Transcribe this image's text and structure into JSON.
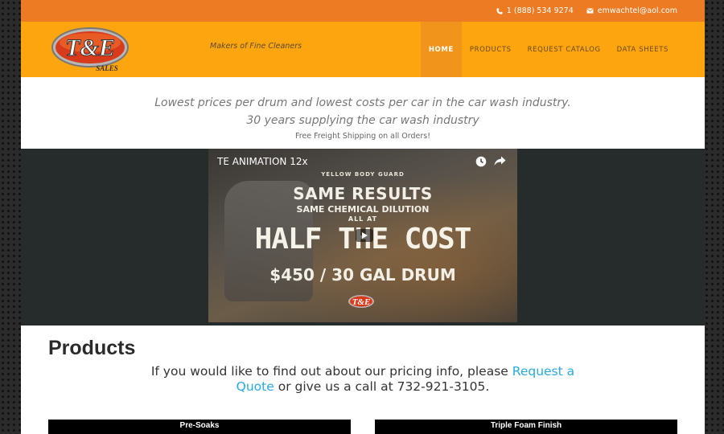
{
  "topbar": {
    "phone": "1 (888) 534 9274",
    "email": "emwachtel@aol.com"
  },
  "header": {
    "logo_text": "T&E",
    "logo_sub": "SALES",
    "tagline": "Makers of Fine Cleaners",
    "nav": [
      {
        "label": "HOME",
        "active": true
      },
      {
        "label": "PRODUCTS",
        "active": false
      },
      {
        "label": "REQUEST CATALOG",
        "active": false
      },
      {
        "label": "DATA SHEETS",
        "active": false
      }
    ]
  },
  "intro": {
    "line1": "Lowest prices per drum and lowest costs per car in the car wash industry.",
    "line2": "30 years supplying the car wash industry",
    "line3": "Free Freight Shipping on all Orders!"
  },
  "video": {
    "title": "TE ANIMATION 12x",
    "overlay_small": "YELLOW BODY GUARD",
    "overlay_big": "SAME RESULTS",
    "overlay_sub": "SAME CHEMICAL DILUTION",
    "overlay_allat": "ALL AT",
    "overlay_huge": "HALF THE COST",
    "overlay_price": "$450 / 30 GAL DRUM",
    "icons": [
      "clock-icon",
      "share-icon",
      "play-icon"
    ]
  },
  "products": {
    "heading": "Products",
    "pricing_pre": "If you would like to find out about our pricing info, please ",
    "pricing_link": "Request a Quote",
    "pricing_post": " or give us a call at 732-921-3105.",
    "tables": [
      "Pre-Soaks",
      "Triple Foam Finish"
    ]
  },
  "colors": {
    "topbar": "#ec7b24",
    "header": "#fda50f",
    "nav_active": "#f0941b",
    "link": "#29a9e1",
    "band": "#262c2b"
  }
}
